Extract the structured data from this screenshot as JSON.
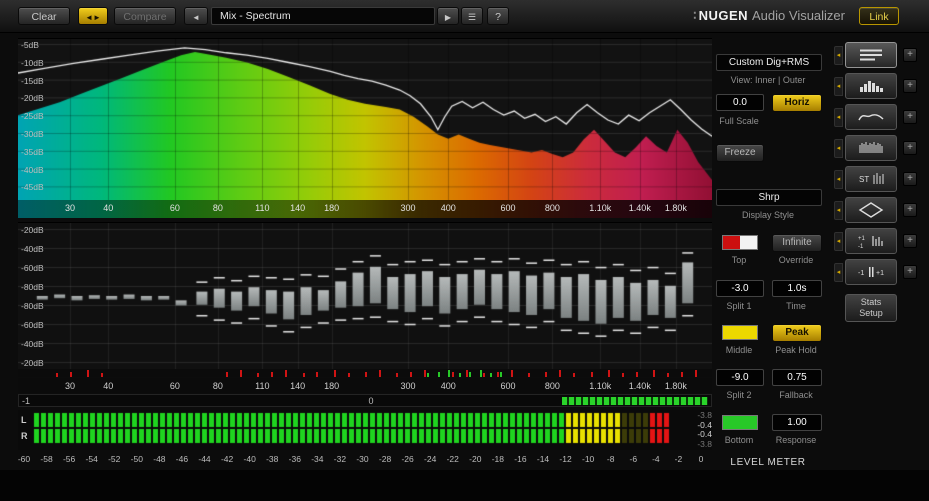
{
  "toolbar": {
    "clear": "Clear",
    "compare": "Compare",
    "preset": "Mix - Spectrum",
    "help": "?",
    "brand_dots": "∶",
    "brand_name": "NUGEN",
    "brand_suffix": "Audio Visualizer",
    "link": "Link"
  },
  "icons": {
    "back": "◄",
    "left": "◄",
    "right": "►",
    "play": "▶",
    "list": "☰",
    "plus": "+",
    "collapse": "◂"
  },
  "spectrum": {
    "db_labels": [
      "-5dB",
      "-10dB",
      "-15dB",
      "-20dB",
      "-25dB",
      "-30dB",
      "-35dB",
      "-40dB",
      "-45dB"
    ],
    "freq_labels": [
      "30",
      "40",
      "60",
      "80",
      "110",
      "140",
      "180",
      "300",
      "400",
      "600",
      "800",
      "1.10k",
      "1.40k",
      "1.80k"
    ],
    "freq_positions": [
      0.075,
      0.13,
      0.226,
      0.288,
      0.352,
      0.403,
      0.452,
      0.562,
      0.62,
      0.706,
      0.77,
      0.839,
      0.896,
      0.948
    ],
    "gradient": [
      [
        0,
        "#00a4b4"
      ],
      [
        0.12,
        "#00b87c"
      ],
      [
        0.22,
        "#22c822"
      ],
      [
        0.32,
        "#5ecc14"
      ],
      [
        0.42,
        "#96cc08"
      ],
      [
        0.5,
        "#c2c400"
      ],
      [
        0.58,
        "#d49600"
      ],
      [
        0.66,
        "#dc6c00"
      ],
      [
        0.74,
        "#d44414"
      ],
      [
        0.82,
        "#cc2c3c"
      ],
      [
        0.9,
        "#c01e50"
      ],
      [
        1,
        "#921034"
      ]
    ],
    "fill": [
      [
        0,
        0.53
      ],
      [
        0.03,
        0.57
      ],
      [
        0.06,
        0.61
      ],
      [
        0.09,
        0.66
      ],
      [
        0.12,
        0.71
      ],
      [
        0.15,
        0.76
      ],
      [
        0.18,
        0.81
      ],
      [
        0.21,
        0.86
      ],
      [
        0.235,
        0.9
      ],
      [
        0.255,
        0.92
      ],
      [
        0.275,
        0.905
      ],
      [
        0.3,
        0.885
      ],
      [
        0.33,
        0.855
      ],
      [
        0.36,
        0.815
      ],
      [
        0.39,
        0.765
      ],
      [
        0.42,
        0.715
      ],
      [
        0.45,
        0.66
      ],
      [
        0.475,
        0.625
      ],
      [
        0.5,
        0.6
      ],
      [
        0.53,
        0.58
      ],
      [
        0.55,
        0.565
      ],
      [
        0.57,
        0.52
      ],
      [
        0.59,
        0.46
      ],
      [
        0.605,
        0.41
      ],
      [
        0.62,
        0.385
      ],
      [
        0.635,
        0.41
      ],
      [
        0.65,
        0.385
      ],
      [
        0.665,
        0.36
      ],
      [
        0.68,
        0.345
      ],
      [
        0.7,
        0.33
      ],
      [
        0.72,
        0.315
      ],
      [
        0.74,
        0.3
      ],
      [
        0.755,
        0.315
      ],
      [
        0.77,
        0.29
      ],
      [
        0.785,
        0.27
      ],
      [
        0.8,
        0.3
      ],
      [
        0.815,
        0.38
      ],
      [
        0.83,
        0.44
      ],
      [
        0.845,
        0.37
      ],
      [
        0.86,
        0.3
      ],
      [
        0.875,
        0.27
      ],
      [
        0.89,
        0.33
      ],
      [
        0.905,
        0.4
      ],
      [
        0.92,
        0.34
      ],
      [
        0.935,
        0.3
      ],
      [
        0.95,
        0.44
      ],
      [
        0.965,
        0.36
      ],
      [
        0.98,
        0.24
      ],
      [
        1,
        0.13
      ]
    ],
    "line": [
      [
        0,
        0.79
      ],
      [
        0.04,
        0.82
      ],
      [
        0.08,
        0.85
      ],
      [
        0.12,
        0.875
      ],
      [
        0.16,
        0.9
      ],
      [
        0.2,
        0.925
      ],
      [
        0.24,
        0.945
      ],
      [
        0.27,
        0.935
      ],
      [
        0.3,
        0.915
      ],
      [
        0.33,
        0.9
      ],
      [
        0.36,
        0.88
      ],
      [
        0.39,
        0.855
      ],
      [
        0.42,
        0.83
      ],
      [
        0.45,
        0.8
      ],
      [
        0.47,
        0.775
      ],
      [
        0.49,
        0.755
      ],
      [
        0.51,
        0.74
      ],
      [
        0.53,
        0.715
      ],
      [
        0.55,
        0.685
      ],
      [
        0.565,
        0.65
      ],
      [
        0.58,
        0.6
      ],
      [
        0.595,
        0.52
      ],
      [
        0.605,
        0.44
      ],
      [
        0.615,
        0.52
      ],
      [
        0.625,
        0.585
      ],
      [
        0.64,
        0.615
      ],
      [
        0.655,
        0.575
      ],
      [
        0.67,
        0.61
      ],
      [
        0.685,
        0.565
      ],
      [
        0.7,
        0.53
      ],
      [
        0.715,
        0.555
      ],
      [
        0.73,
        0.51
      ],
      [
        0.745,
        0.535
      ],
      [
        0.76,
        0.49
      ],
      [
        0.775,
        0.52
      ],
      [
        0.79,
        0.475
      ],
      [
        0.805,
        0.545
      ],
      [
        0.82,
        0.595
      ],
      [
        0.835,
        0.545
      ],
      [
        0.85,
        0.5
      ],
      [
        0.865,
        0.475
      ],
      [
        0.88,
        0.53
      ],
      [
        0.895,
        0.495
      ],
      [
        0.91,
        0.545
      ],
      [
        0.925,
        0.585
      ],
      [
        0.94,
        0.625
      ],
      [
        0.955,
        0.565
      ],
      [
        0.97,
        0.5
      ],
      [
        0.985,
        0.445
      ],
      [
        1,
        0.4
      ]
    ]
  },
  "histogram": {
    "db_labels": [
      "-20dB",
      "-40dB",
      "-60dB",
      "-80dB",
      "-80dB",
      "-60dB",
      "-40dB",
      "-20dB"
    ],
    "bars": [
      [
        0.035,
        0.5,
        0.525,
        null,
        null
      ],
      [
        0.06,
        0.49,
        0.515,
        null,
        null
      ],
      [
        0.085,
        0.5,
        0.53,
        null,
        null
      ],
      [
        0.11,
        0.495,
        0.52,
        null,
        null
      ],
      [
        0.135,
        0.5,
        0.525,
        null,
        null
      ],
      [
        0.16,
        0.49,
        0.52,
        null,
        null
      ],
      [
        0.185,
        0.5,
        0.53,
        null,
        null
      ],
      [
        0.21,
        0.5,
        0.525,
        null,
        null
      ],
      [
        0.235,
        0.53,
        0.565,
        null,
        null
      ],
      [
        0.265,
        0.47,
        0.56,
        0.4,
        0.63
      ],
      [
        0.29,
        0.45,
        0.58,
        0.37,
        0.66
      ],
      [
        0.315,
        0.47,
        0.6,
        0.39,
        0.68
      ],
      [
        0.34,
        0.44,
        0.57,
        0.36,
        0.65
      ],
      [
        0.365,
        0.46,
        0.62,
        0.37,
        0.7
      ],
      [
        0.39,
        0.47,
        0.66,
        0.38,
        0.74
      ],
      [
        0.415,
        0.44,
        0.63,
        0.35,
        0.71
      ],
      [
        0.44,
        0.46,
        0.6,
        0.36,
        0.68
      ],
      [
        0.465,
        0.4,
        0.58,
        0.31,
        0.66
      ],
      [
        0.49,
        0.34,
        0.57,
        0.26,
        0.65
      ],
      [
        0.515,
        0.3,
        0.55,
        0.22,
        0.64
      ],
      [
        0.54,
        0.37,
        0.59,
        0.28,
        0.67
      ],
      [
        0.565,
        0.35,
        0.61,
        0.26,
        0.69
      ],
      [
        0.59,
        0.33,
        0.57,
        0.25,
        0.65
      ],
      [
        0.615,
        0.37,
        0.62,
        0.28,
        0.7
      ],
      [
        0.64,
        0.35,
        0.59,
        0.26,
        0.67
      ],
      [
        0.665,
        0.32,
        0.56,
        0.24,
        0.64
      ],
      [
        0.69,
        0.35,
        0.59,
        0.26,
        0.67
      ],
      [
        0.715,
        0.33,
        0.61,
        0.24,
        0.69
      ],
      [
        0.74,
        0.36,
        0.63,
        0.27,
        0.71
      ],
      [
        0.765,
        0.34,
        0.59,
        0.25,
        0.67
      ],
      [
        0.79,
        0.37,
        0.65,
        0.28,
        0.73
      ],
      [
        0.815,
        0.35,
        0.67,
        0.26,
        0.75
      ],
      [
        0.84,
        0.39,
        0.69,
        0.3,
        0.77
      ],
      [
        0.865,
        0.37,
        0.65,
        0.28,
        0.73
      ],
      [
        0.89,
        0.41,
        0.67,
        0.32,
        0.75
      ],
      [
        0.915,
        0.39,
        0.63,
        0.3,
        0.71
      ],
      [
        0.94,
        0.43,
        0.65,
        0.34,
        0.73
      ],
      [
        0.965,
        0.27,
        0.55,
        0.2,
        0.63
      ]
    ]
  },
  "peak_ticks": {
    "red": [
      0.055,
      0.075,
      0.1,
      0.12,
      0.3,
      0.32,
      0.345,
      0.365,
      0.385,
      0.41,
      0.43,
      0.455,
      0.475,
      0.5,
      0.52,
      0.545,
      0.565,
      0.585,
      0.605,
      0.625,
      0.645,
      0.67,
      0.69,
      0.71,
      0.735,
      0.76,
      0.78,
      0.8,
      0.825,
      0.85,
      0.87,
      0.89,
      0.915,
      0.935,
      0.955,
      0.975
    ],
    "green": [
      0.59,
      0.605,
      0.62,
      0.635,
      0.65,
      0.665,
      0.68,
      0.695
    ]
  },
  "correlation": {
    "left_label": "-1",
    "zero_label": "0",
    "fill_start": 0.785,
    "fill_end": 0.995,
    "color": "#2ad42a"
  },
  "meter": {
    "channel_labels": [
      "L",
      "R"
    ],
    "readouts": [
      {
        "text": "-3.8",
        "dim": true
      },
      {
        "text": "-0.4",
        "dim": false
      },
      {
        "text": "-0.4",
        "dim": false
      },
      {
        "text": "-3.8",
        "dim": true
      }
    ],
    "scale_labels": [
      "-60",
      "-58",
      "-56",
      "-54",
      "-52",
      "-50",
      "-48",
      "-46",
      "-44",
      "-42",
      "-40",
      "-38",
      "-36",
      "-34",
      "-32",
      "-30",
      "-28",
      "-26",
      "-24",
      "-22",
      "-20",
      "-18",
      "-16",
      "-14",
      "-12",
      "-10",
      "-8",
      "-6",
      "-4",
      "-2",
      "0"
    ],
    "green_end": 0.84,
    "yellow_end": 0.968,
    "lit_fraction": 0.932,
    "colors": {
      "green": "#1fd41f",
      "green_dim": "#123912",
      "yellow": "#e8e000",
      "yellow_dim": "#3c3c08",
      "red": "#e41414"
    }
  },
  "controls": {
    "mode": "Custom Dig+RMS",
    "view_label": "View: Inner | Outer",
    "full_scale_value": "0.0",
    "horiz": "Horiz",
    "full_scale_label": "Full Scale",
    "freeze": "Freeze",
    "display_style_value": "Shrp",
    "display_style_label": "Display Style",
    "top_label": "Top",
    "override_value": "Infinite",
    "override_label": "Override",
    "split1_value": "-3.0",
    "split1_label": "Split 1",
    "time_value": "1.0s",
    "time_label": "Time",
    "middle_label": "Middle",
    "peak_value": "Peak",
    "peak_label": "Peak Hold",
    "split2_value": "-9.0",
    "split2_label": "Split 2",
    "fallback_value": "0.75",
    "fallback_label": "Fallback",
    "bottom_label": "Bottom",
    "response_value": "1.00",
    "response_label": "Response",
    "meter_title": "LEVEL METER"
  },
  "sidebar": {
    "stats_setup": [
      "Stats",
      "Setup"
    ],
    "items": [
      {
        "name": "meter-view",
        "icon": "meter-lines-icon"
      },
      {
        "name": "histogram-view",
        "icon": "histogram-bars-icon"
      },
      {
        "name": "spectrum-view",
        "icon": "spectrum-wave-icon"
      },
      {
        "name": "spectrogram-view",
        "icon": "spectrogram-lines-icon"
      },
      {
        "name": "stereo-spectrum-view",
        "icon": "stereo-lines-icon",
        "text": "ST"
      },
      {
        "name": "vectorscope-view",
        "icon": "vectorscope-diamond-icon"
      },
      {
        "name": "balance-view",
        "icon": "balance-bars-icon",
        "top": "+1",
        "bottom": "-1"
      },
      {
        "name": "correlation-view",
        "icon": "correlation-range-icon",
        "left": "-1",
        "right": "+1"
      }
    ]
  }
}
